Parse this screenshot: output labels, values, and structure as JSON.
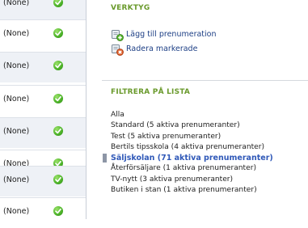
{
  "table": {
    "rows": [
      {
        "status": "(None)",
        "active": true
      },
      {
        "status": "(None)",
        "active": true
      },
      {
        "status": "(None)",
        "active": true
      },
      {
        "status": "(None)",
        "active": true
      },
      {
        "status": "(None)",
        "active": true
      },
      {
        "status": "(None)",
        "active": true
      },
      {
        "status": "(None)",
        "active": true
      },
      {
        "status": "(None)",
        "active": true
      }
    ]
  },
  "tools": {
    "title": "VERKTYG",
    "actions": [
      {
        "label": "Lägg till prenumeration",
        "icon": "add-subscription-icon"
      },
      {
        "label": "Radera markerade",
        "icon": "delete-selected-icon"
      }
    ]
  },
  "filter": {
    "title": "FILTRERA PÅ LISTA",
    "items": [
      {
        "label": "Alla",
        "selected": false
      },
      {
        "label": "Standard (5 aktiva prenumeranter)",
        "selected": false
      },
      {
        "label": "Test (5 aktiva prenumeranter)",
        "selected": false
      },
      {
        "label": "Bertils tipsskola (4 aktiva prenumeranter)",
        "selected": false
      },
      {
        "label": "Säljskolan (71 aktiva prenumeranter)",
        "selected": true
      },
      {
        "label": "Återförsäljare (1 aktiva prenumeranter)",
        "selected": false
      },
      {
        "label": "TV-nytt (3 aktiva prenumeranter)",
        "selected": false
      },
      {
        "label": "Butiken i stan (1 aktiva prenumeranter)",
        "selected": false
      }
    ]
  },
  "colors": {
    "section_title": "#6a9a2c",
    "link": "#1d3f85",
    "selected_filter": "#2f58b8",
    "status_ok": "#4fb52a"
  }
}
